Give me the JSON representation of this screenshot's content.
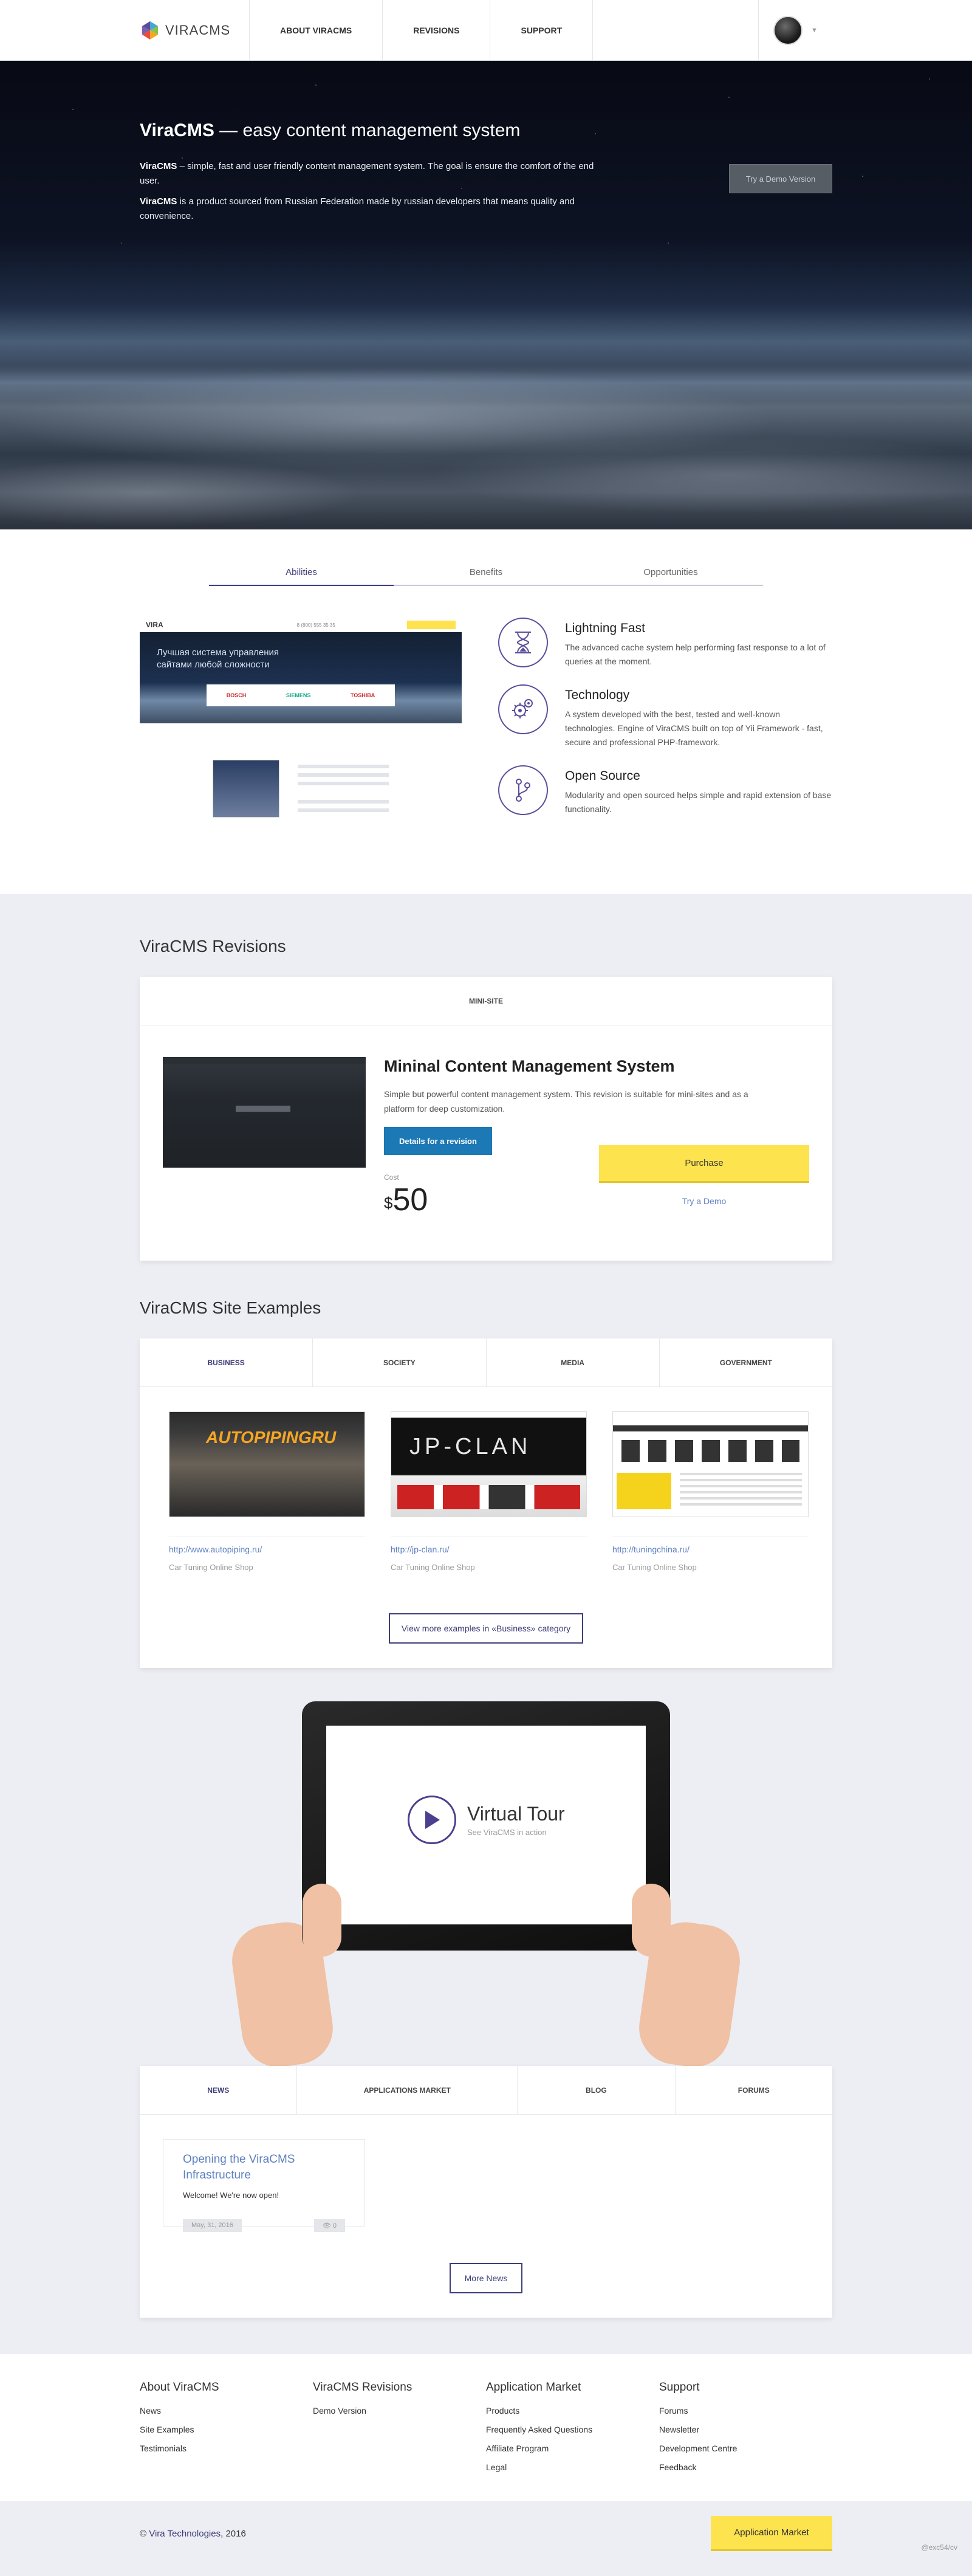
{
  "header": {
    "logo_text": "VIRACMS",
    "nav": [
      "ABOUT VIRACMS",
      "REVISIONS",
      "SUPPORT"
    ]
  },
  "hero": {
    "title_strong": "ViraCMS",
    "title_rest": " — easy content management system",
    "p1_strong": "ViraCMS",
    "p1_rest": " – simple, fast and user friendly content management system. The goal is ensure the comfort of the end user.",
    "p2_strong": "ViraCMS",
    "p2_rest": " is a product sourced from Russian Federation made by russian developers that means quality and convenience.",
    "demo_button": "Try a Demo Version"
  },
  "features": {
    "tabs": [
      "Abilities",
      "Benefits",
      "Opportunities"
    ],
    "mock": {
      "logo": "VIRA",
      "phone": "8 (800) 555 35 35",
      "headline": "Лучшая система управления сайтами любой сложности",
      "brands": [
        "BOSCH",
        "SIEMENS",
        "TOSHIBA"
      ]
    },
    "items": [
      {
        "icon": "hourglass-icon",
        "title": "Lightning Fast",
        "text": "The advanced cache system help performing fast response to a lot of queries at the moment."
      },
      {
        "icon": "gears-icon",
        "title": "Technology",
        "text": "A system developed with the best, tested and well-known technologies. Engine of ViraCMS built on top of Yii Framework - fast, secure and professional PHP-framework."
      },
      {
        "icon": "branch-icon",
        "title": "Open Source",
        "text": "Modularity and open sourced helps simple and rapid extension of base functionality."
      }
    ]
  },
  "revisions": {
    "title": "ViraCMS Revisions",
    "tab": "MINI-SITE",
    "name": "Mininal Content Management System",
    "desc": "Simple but powerful content management system. This revision is suitable for mini-sites and as a platform for deep customization.",
    "details_button": "Details for a revision",
    "cost_label": "Cost",
    "currency": "$",
    "price": "50",
    "purchase_button": "Purchase",
    "try_demo": "Try a Demo"
  },
  "examples": {
    "title": "ViraCMS Site Examples",
    "tabs": [
      "BUSINESS",
      "SOCIETY",
      "MEDIA",
      "GOVERNMENT"
    ],
    "items": [
      {
        "url": "http://www.autopiping.ru/",
        "category": "Car Tuning Online Shop",
        "banner": "AUTOPIPINGRU"
      },
      {
        "url": "http://jp-clan.ru/",
        "category": "Car Tuning Online Shop",
        "banner": "JP-CLAN"
      },
      {
        "url": "http://tuningchina.ru/",
        "category": "Car Tuning Online Shop",
        "banner": ""
      }
    ],
    "more_button": "View more examples in «Business» category"
  },
  "tour": {
    "title": "Virtual Tour",
    "subtitle": "See ViraCMS in action"
  },
  "news": {
    "tabs": [
      "NEWS",
      "APPLICATIONS MARKET",
      "BLOG",
      "FORUMS"
    ],
    "item": {
      "title": "Opening the ViraCMS Infrastructure",
      "body": "Welcome! We're now open!",
      "date": "May, 31, 2016",
      "views": "0"
    },
    "more_button": "More News"
  },
  "footer": {
    "cols": [
      {
        "title": "About ViraCMS",
        "links": [
          "News",
          "Site Examples",
          "Testimonials"
        ]
      },
      {
        "title": "ViraCMS Revisions",
        "links": [
          "Demo Version"
        ]
      },
      {
        "title": "Application Market",
        "links": [
          "Products",
          "Frequently Asked Questions",
          "Affiliate Program",
          "Legal"
        ]
      },
      {
        "title": "Support",
        "links": [
          "Forums",
          "Newsletter",
          "Development Centre",
          "Feedback"
        ]
      }
    ],
    "copyright_prefix": "© ",
    "company": "Vira Technologies",
    "year": ", 2016",
    "app_market_button": "Application Market",
    "tag": "@exc54/cv"
  },
  "colors": {
    "accent": "#3d3d7a",
    "yellow": "#fde34e",
    "blue": "#1c79b5",
    "link": "#5d7fbf"
  }
}
